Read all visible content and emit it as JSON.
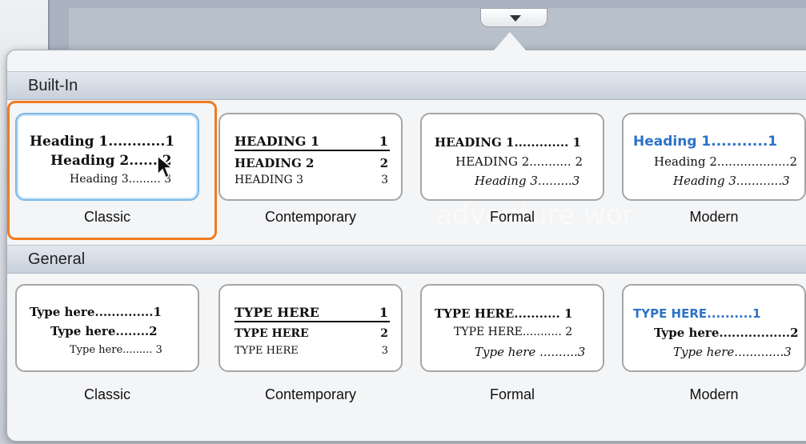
{
  "sections": {
    "builtin": "Built-In",
    "general": "General"
  },
  "builtin": [
    {
      "name": "Classic",
      "l1": "Heading 1............1",
      "l2": "Heading 2.......2",
      "l3": "Heading 3......... 3"
    },
    {
      "name": "Contemporary",
      "l1a": "HEADING 1",
      "l1b": "1",
      "l2a": "HEADING 2",
      "l2b": "2",
      "l3a": "HEADING 3",
      "l3b": "3"
    },
    {
      "name": "Formal",
      "l1": "HEADING 1............. 1",
      "l2": "HEADING 2........... 2",
      "l3": "Heading 3.........3"
    },
    {
      "name": "Modern",
      "l1": "Heading 1...........1",
      "l2": "Heading 2...................2",
      "l3": "Heading 3............3"
    }
  ],
  "general": [
    {
      "name": "Classic",
      "l1": "Type here..............1",
      "l2": "Type here........2",
      "l3": "Type here......... 3"
    },
    {
      "name": "Contemporary",
      "l1a": "TYPE HERE",
      "l1b": "1",
      "l2a": "TYPE HERE",
      "l2b": "2",
      "l3a": "TYPE HERE",
      "l3b": "3"
    },
    {
      "name": "Formal",
      "l1": "TYPE HERE........... 1",
      "l2": "TYPE HERE........... 2",
      "l3": "Type here ..........3"
    },
    {
      "name": "Modern",
      "l1": "TYPE HERE..........1",
      "l2": "Type here.................2",
      "l3": "Type here.............3"
    }
  ],
  "background_text": "adventure wor",
  "colors": {
    "highlight": "#f07a1e",
    "modern_blue": "#2c73c9",
    "selected_border": "#7bb8e8"
  }
}
